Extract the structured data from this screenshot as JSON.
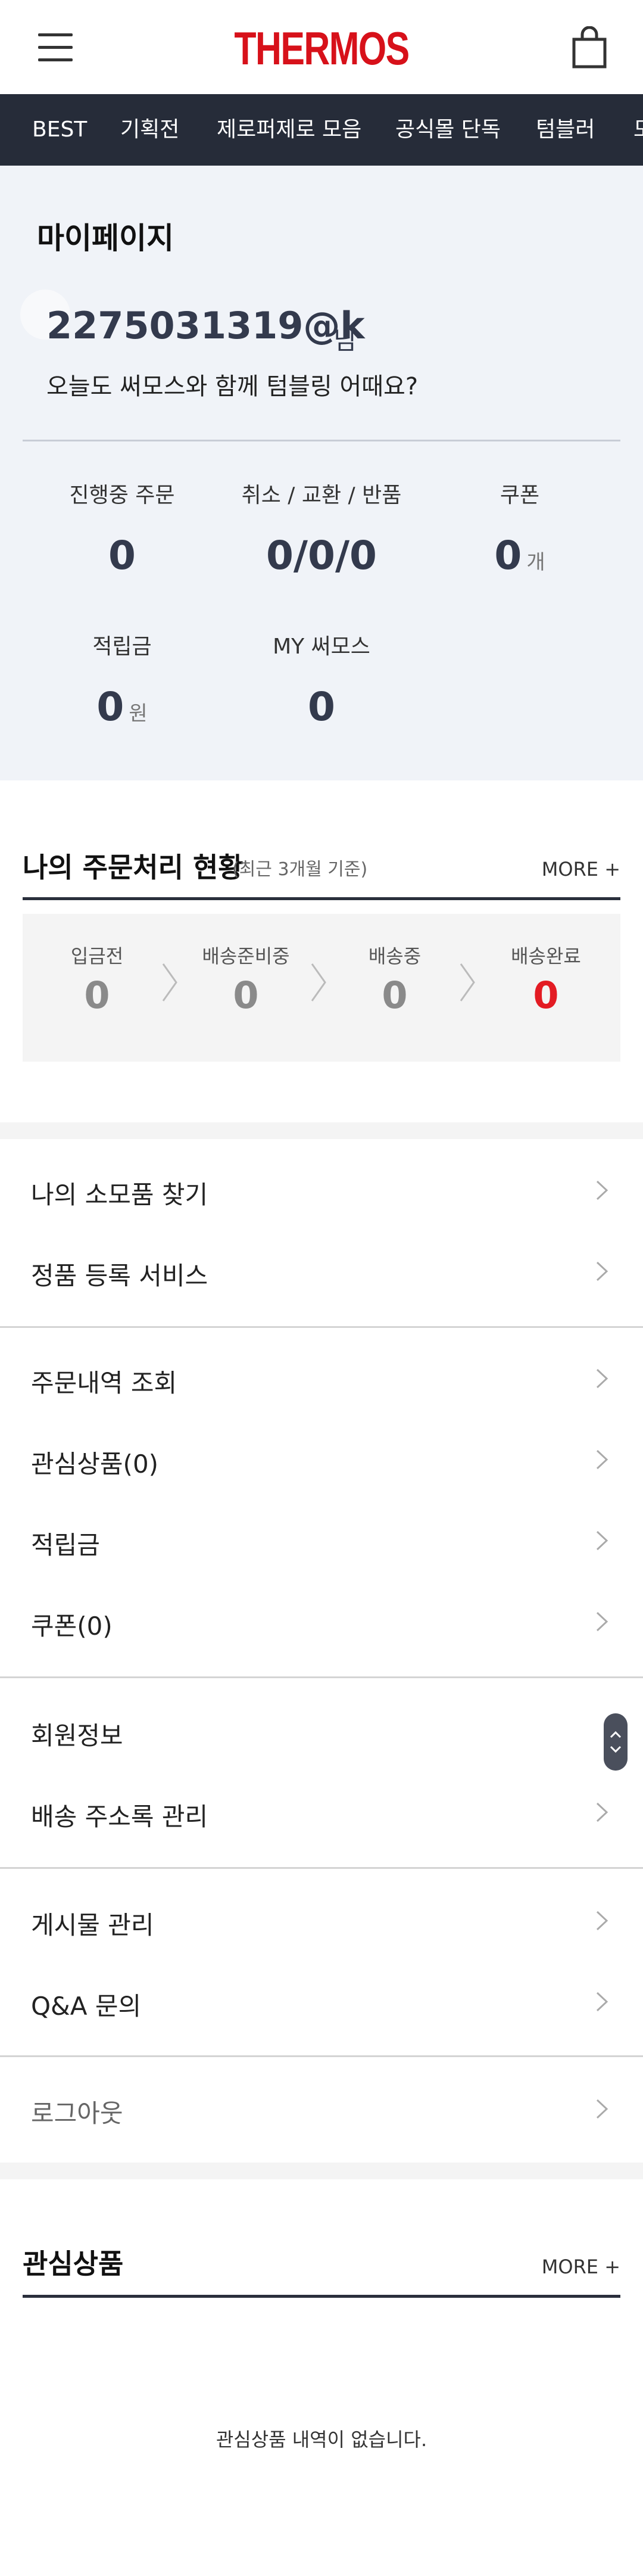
{
  "header": {
    "logo": "THERMOS",
    "menu_icon": "hamburger-menu-icon",
    "cart_icon": "shopping-bag-icon",
    "brand_color": "#d7111a"
  },
  "nav": {
    "items": [
      "BEST",
      "기획전",
      "제로퍼제로 모음",
      "공식몰 단독",
      "텀블러",
      "모"
    ]
  },
  "mypage": {
    "title": "마이페이지",
    "user_id": "2275031319@k",
    "user_suffix": "님",
    "greeting": "오늘도 써모스와 함께 텀블링 어때요?",
    "stats": [
      {
        "label": "진행중 주문",
        "value": "0",
        "unit": ""
      },
      {
        "label": "취소 / 교환 / 반품",
        "value": "0/0/0",
        "unit": ""
      },
      {
        "label": "쿠폰",
        "value": "0",
        "unit": "개"
      },
      {
        "label": "적립금",
        "value": "0",
        "unit": "원"
      },
      {
        "label": "MY 써모스",
        "value": "0",
        "unit": ""
      }
    ]
  },
  "order_status": {
    "title": "나의 주문처리 현황",
    "subtitle": "(최근 3개월 기준)",
    "more": "MORE +",
    "steps": [
      {
        "label": "입금전",
        "value": "0"
      },
      {
        "label": "배송준비중",
        "value": "0"
      },
      {
        "label": "배송중",
        "value": "0"
      },
      {
        "label": "배송완료",
        "value": "0"
      }
    ],
    "highlight_color": "#e31b23"
  },
  "menu": {
    "groups": [
      [
        "나의 소모품 찾기",
        "정품 등록 서비스"
      ],
      [
        "주문내역 조회",
        "관심상품(0)",
        "적립금",
        "쿠폰(0)"
      ],
      [
        "회원정보",
        "배송 주소록 관리"
      ],
      [
        "게시물 관리",
        "Q&A 문의"
      ],
      [
        "로그아웃"
      ]
    ]
  },
  "wishlist": {
    "title": "관심상품",
    "more": "MORE +",
    "empty_message": "관심상품 내역이 없습니다."
  }
}
